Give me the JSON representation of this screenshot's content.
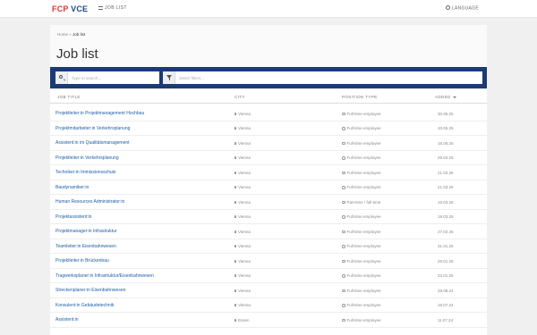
{
  "brand": {
    "fcp": "FCP",
    "vce": "VCE"
  },
  "nav": {
    "job_list": "JOB LIST",
    "language": "LANGUAGE"
  },
  "breadcrumb": {
    "home": "Home",
    "sep": "»",
    "current": "Job list"
  },
  "page_title": "Job list",
  "search": {
    "placeholder": "Type to search..."
  },
  "filter": {
    "placeholder": "Select filters..."
  },
  "table": {
    "headers": {
      "title": "JOB TITLE",
      "city": "CITY",
      "type": "POSITION TYPE",
      "added": "ADDED"
    },
    "rows": [
      {
        "title": "Projektleiter:in Projektmanagement Hochbau",
        "city": "Vienna",
        "type": "Full-time employee",
        "added": "30.05.25"
      },
      {
        "title": "Projektmitarbeiter:in Verkehrsplanung",
        "city": "Vienna",
        "type": "Full-time employee",
        "added": "20.05.25"
      },
      {
        "title": "Assistent:in im Qualitätsmanagement",
        "city": "Vienna",
        "type": "Full-time employee",
        "added": "16.05.25"
      },
      {
        "title": "Projektleiter:in Verkehrsplanung",
        "city": "Vienna",
        "type": "Full-time employee",
        "added": "29.04.25"
      },
      {
        "title": "Techniker:in Immissionsschutz",
        "city": "Vienna",
        "type": "Full-time employee",
        "added": "21.03.25"
      },
      {
        "title": "Baudynamiker:in",
        "city": "Vienna",
        "type": "Full-time employee",
        "added": "21.03.25"
      },
      {
        "title": "Human Resources Administrator:in",
        "city": "Vienna",
        "type": "Part-time / full-time",
        "added": "19.03.25"
      },
      {
        "title": "Projektassistent:in",
        "city": "Vienna",
        "type": "Full-time employee",
        "added": "19.03.25"
      },
      {
        "title": "Projektmanager:in Infrastruktur",
        "city": "Vienna",
        "type": "Full-time employee",
        "added": "27.02.25"
      },
      {
        "title": "Teamleiter:in Eisenbahnwesen",
        "city": "Vienna",
        "type": "Full-time employee",
        "added": "31.01.25"
      },
      {
        "title": "Projektleiter:in Brückenbau",
        "city": "Vienna",
        "type": "Full-time employee",
        "added": "29.01.25"
      },
      {
        "title": "Tragwerksplaner:in Infrastruktur/Eisenbahnwesen",
        "city": "Vienna",
        "type": "Full-time employee",
        "added": "23.01.25"
      },
      {
        "title": "Streckenplaner:in Eisenbahnwesen",
        "city": "Vienna",
        "type": "Full-time employee",
        "added": "28.08.24"
      },
      {
        "title": "Konsulent:in Gebäudetechnik",
        "city": "Vienna",
        "type": "Full-time employee",
        "added": "16.07.24"
      },
      {
        "title": "Assistent:in",
        "city": "Essen",
        "type": "Full-time employee",
        "added": "11.07.24"
      }
    ]
  }
}
